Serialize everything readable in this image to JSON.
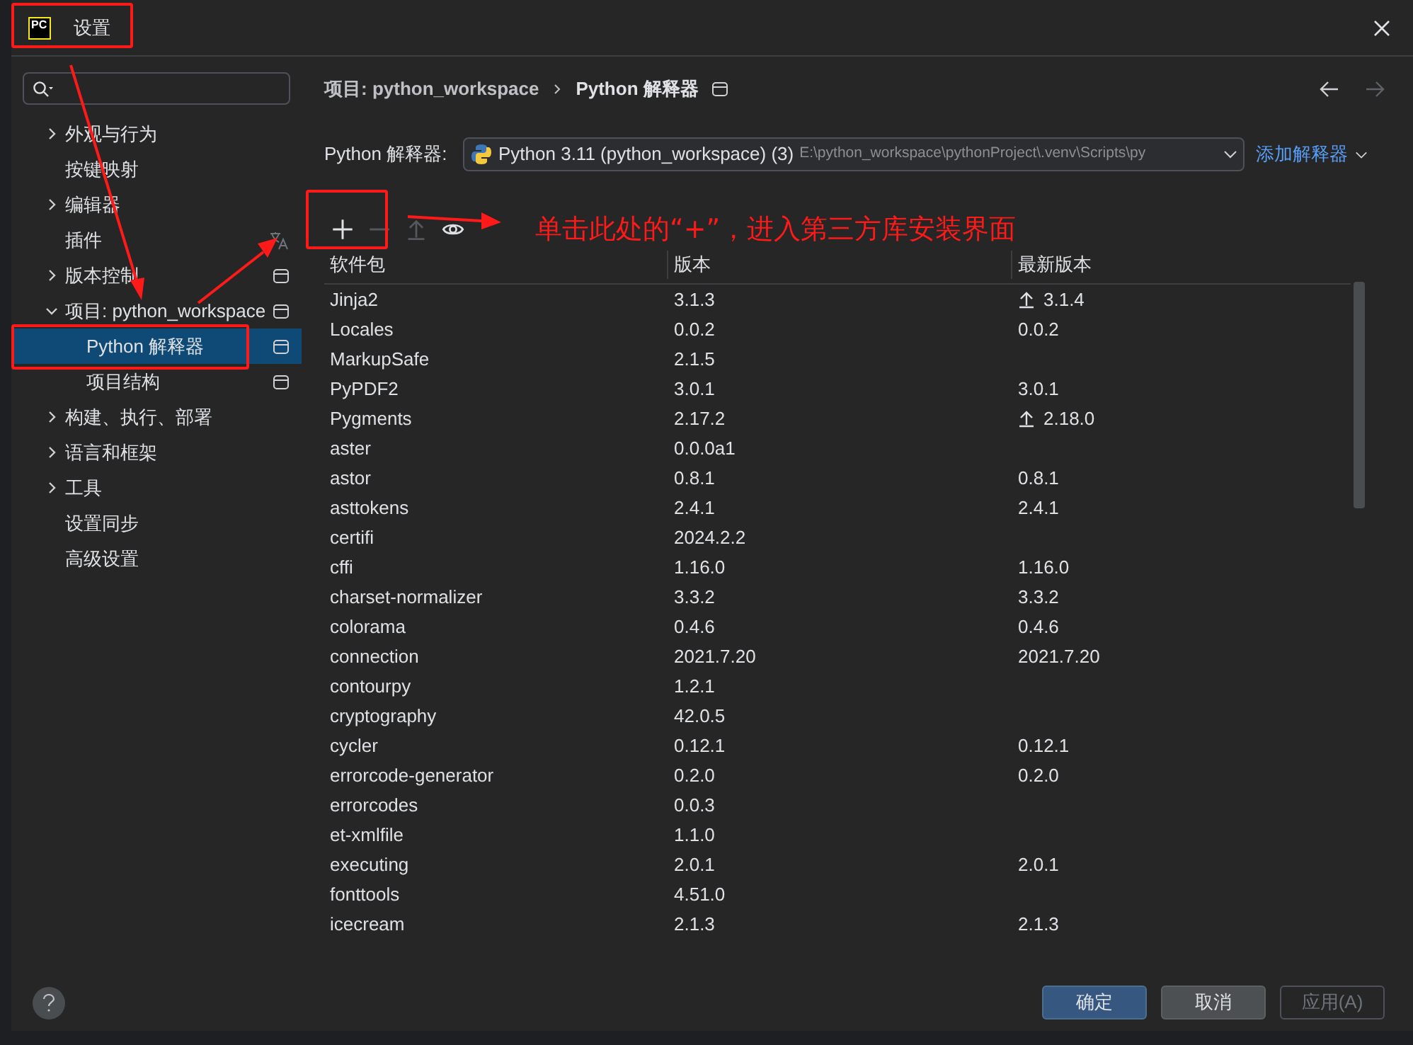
{
  "window": {
    "logo": "PC",
    "title": "设置"
  },
  "sidebar": {
    "items": [
      {
        "label": "外观与行为",
        "kind": "group",
        "expanded": false
      },
      {
        "label": "按键映射",
        "kind": "leaf"
      },
      {
        "label": "编辑器",
        "kind": "group",
        "expanded": false
      },
      {
        "label": "插件",
        "kind": "leaf",
        "translatable": true
      },
      {
        "label": "版本控制",
        "kind": "group",
        "expanded": false,
        "project_scoped": true
      },
      {
        "label": "项目: python_workspace",
        "kind": "group",
        "expanded": true,
        "project_scoped": true,
        "children": [
          {
            "label": "Python 解释器",
            "project_scoped": true,
            "selected": true
          },
          {
            "label": "项目结构",
            "project_scoped": true,
            "selected": false
          }
        ]
      },
      {
        "label": "构建、执行、部署",
        "kind": "group",
        "expanded": false
      },
      {
        "label": "语言和框架",
        "kind": "group",
        "expanded": false
      },
      {
        "label": "工具",
        "kind": "group",
        "expanded": false
      },
      {
        "label": "设置同步",
        "kind": "leaf"
      },
      {
        "label": "高级设置",
        "kind": "leaf"
      }
    ]
  },
  "breadcrumb": [
    "项目: python_workspace",
    "Python 解释器"
  ],
  "interpreter": {
    "label": "Python 解释器:",
    "name": "Python 3.11 (python_workspace) (3)",
    "path": "E:\\python_workspace\\pythonProject\\.venv\\Scripts\\py",
    "add_link": "添加解释器"
  },
  "toolbar": [
    {
      "kind": "add",
      "disabled": false
    },
    {
      "kind": "remove",
      "disabled": true
    },
    {
      "kind": "upgrade",
      "disabled": true
    },
    {
      "kind": "eye",
      "disabled": false
    }
  ],
  "annotation": {
    "text": "单击此处的“+”，进入第三方库安装界面"
  },
  "table": {
    "columns": [
      "软件包",
      "版本",
      "最新版本"
    ],
    "rows": [
      {
        "name": "Jinja2",
        "version": "3.1.3",
        "latest": "3.1.4",
        "upgrade": true
      },
      {
        "name": "Locales",
        "version": "0.0.2",
        "latest": "0.0.2",
        "upgrade": false
      },
      {
        "name": "MarkupSafe",
        "version": "2.1.5",
        "upgrade": false
      },
      {
        "name": "PyPDF2",
        "version": "3.0.1",
        "latest": "3.0.1",
        "upgrade": false
      },
      {
        "name": "Pygments",
        "version": "2.17.2",
        "latest": "2.18.0",
        "upgrade": true
      },
      {
        "name": "aster",
        "version": "0.0.0a1",
        "upgrade": false
      },
      {
        "name": "astor",
        "version": "0.8.1",
        "latest": "0.8.1",
        "upgrade": false
      },
      {
        "name": "asttokens",
        "version": "2.4.1",
        "latest": "2.4.1",
        "upgrade": false
      },
      {
        "name": "certifi",
        "version": "2024.2.2",
        "upgrade": false
      },
      {
        "name": "cffi",
        "version": "1.16.0",
        "latest": "1.16.0",
        "upgrade": false
      },
      {
        "name": "charset-normalizer",
        "version": "3.3.2",
        "latest": "3.3.2",
        "upgrade": false
      },
      {
        "name": "colorama",
        "version": "0.4.6",
        "latest": "0.4.6",
        "upgrade": false
      },
      {
        "name": "connection",
        "version": "2021.7.20",
        "latest": "2021.7.20",
        "upgrade": false
      },
      {
        "name": "contourpy",
        "version": "1.2.1",
        "upgrade": false
      },
      {
        "name": "cryptography",
        "version": "42.0.5",
        "upgrade": false
      },
      {
        "name": "cycler",
        "version": "0.12.1",
        "latest": "0.12.1",
        "upgrade": false
      },
      {
        "name": "errorcode-generator",
        "version": "0.2.0",
        "latest": "0.2.0",
        "upgrade": false
      },
      {
        "name": "errorcodes",
        "version": "0.0.3",
        "upgrade": false
      },
      {
        "name": "et-xmlfile",
        "version": "1.1.0",
        "upgrade": false
      },
      {
        "name": "executing",
        "version": "2.0.1",
        "latest": "2.0.1",
        "upgrade": false
      },
      {
        "name": "fonttools",
        "version": "4.51.0",
        "upgrade": false
      },
      {
        "name": "icecream",
        "version": "2.1.3",
        "latest": "2.1.3",
        "upgrade": false
      }
    ]
  },
  "buttons": [
    {
      "label": "确定",
      "kind": "primary",
      "disabled": false
    },
    {
      "label": "取消",
      "kind": "secondary",
      "disabled": false
    },
    {
      "label": "应用(A)",
      "kind": "secondary",
      "disabled": true
    }
  ]
}
